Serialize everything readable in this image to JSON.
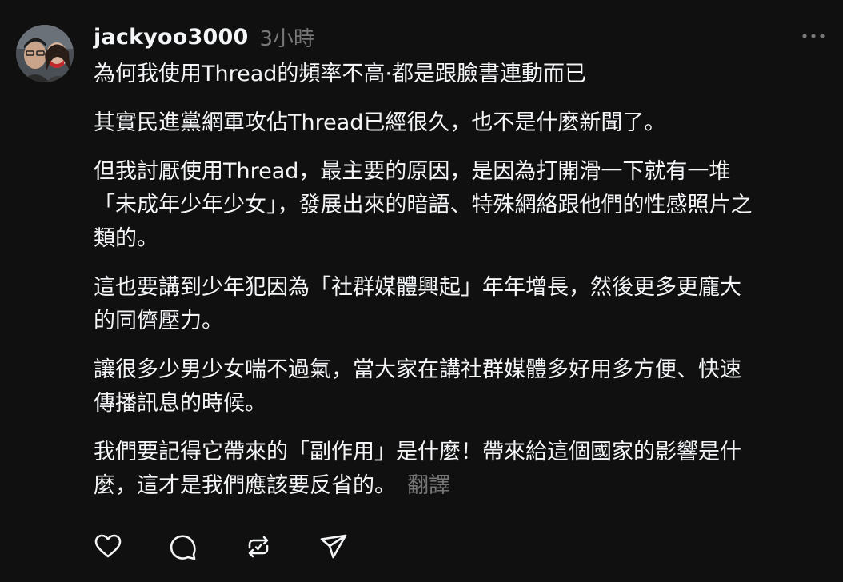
{
  "post": {
    "username": "jackyoo3000",
    "time": "3小時",
    "paragraphs": [
      "為何我使用Thread的頻率不高·都是跟臉書連動而已",
      "其實民進黨網軍攻佔Thread已經很久，也不是什麼新聞了。",
      "但我討厭使用Thread，最主要的原因，是因為打開滑一下就有一堆\n「未成年少年少女」，發展出來的暗語、特殊網絡跟他們的性感照片之\n類的。",
      "這也要講到少年犯因為「社群媒體興起」年年增長，然後更多更龐大\n的同儕壓力。",
      "讓很多少男少女喘不過氣，當大家在講社群媒體多好用多方便、快速\n傳播訊息的時候。",
      "我們要記得它帶來的「副作用」是什麼！帶來給這個國家的影響是什\n麼，這才是我們應該要反省的。"
    ],
    "translate_label": "翻譯"
  },
  "icons": {
    "more": "more-horizontal-icon",
    "like": "heart-icon",
    "comment": "comment-bubble-icon",
    "repost": "repost-icon",
    "share": "share-send-icon"
  },
  "colors": {
    "background": "#101010",
    "text_primary": "#f3f5f7",
    "text_secondary": "#777777"
  }
}
